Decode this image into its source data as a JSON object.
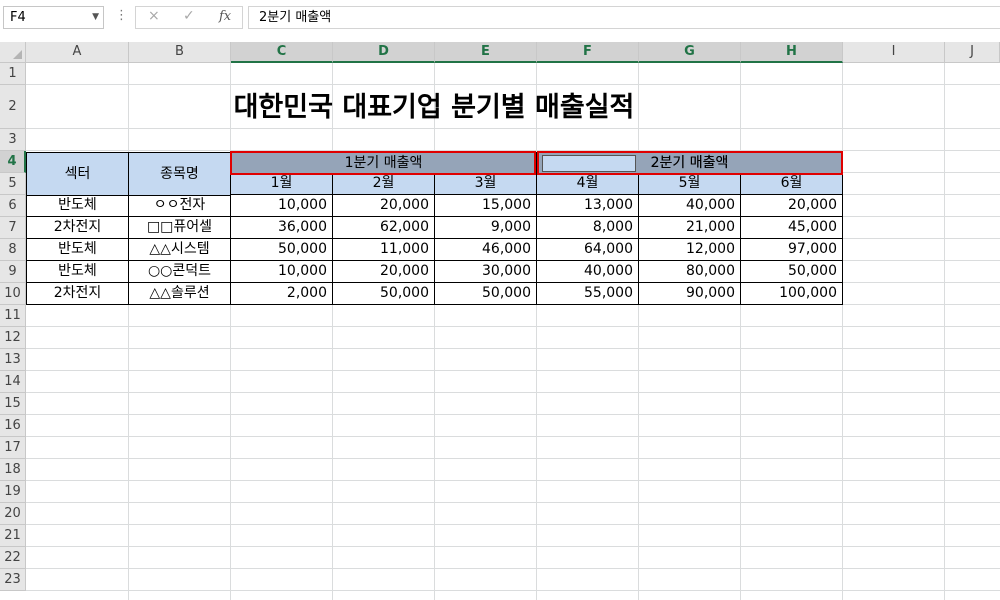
{
  "formula_bar": {
    "name_box": "F4",
    "cancel_icon": "×",
    "enter_icon": "✓",
    "fx_label": "fx",
    "formula": "2분기 매출액"
  },
  "columns": [
    "A",
    "B",
    "C",
    "D",
    "E",
    "F",
    "G",
    "H",
    "I",
    "J"
  ],
  "rows": [
    "1",
    "2",
    "3",
    "4",
    "5",
    "6",
    "7",
    "8",
    "9",
    "10",
    "11",
    "12",
    "13",
    "14",
    "15",
    "16",
    "17",
    "18",
    "19",
    "20",
    "21",
    "22",
    "23"
  ],
  "selected_column_range": [
    "C",
    "D",
    "E",
    "F",
    "G",
    "H"
  ],
  "selected_row": "4",
  "sheet": {
    "title": "대한민국 대표기업 분기별 매출실적",
    "headers": {
      "sector": "섹터",
      "stock": "종목명",
      "q1": "1분기 매출액",
      "q2": "2분기 매출액",
      "months": [
        "1월",
        "2월",
        "3월",
        "4월",
        "5월",
        "6월"
      ]
    },
    "data_rows": [
      {
        "sector": "반도체",
        "stock": "ㅇㅇ전자",
        "values": [
          "10,000",
          "20,000",
          "15,000",
          "13,000",
          "40,000",
          "20,000"
        ]
      },
      {
        "sector": "2차전지",
        "stock": "□□퓨어셀",
        "values": [
          "36,000",
          "62,000",
          "9,000",
          "8,000",
          "21,000",
          "45,000"
        ]
      },
      {
        "sector": "반도체",
        "stock": "△△시스템",
        "values": [
          "50,000",
          "11,000",
          "46,000",
          "64,000",
          "12,000",
          "97,000"
        ]
      },
      {
        "sector": "반도체",
        "stock": "○○콘덕트",
        "values": [
          "10,000",
          "20,000",
          "30,000",
          "40,000",
          "80,000",
          "50,000"
        ]
      },
      {
        "sector": "2차전지",
        "stock": "△△솔루션",
        "values": [
          "2,000",
          "50,000",
          "50,000",
          "55,000",
          "90,000",
          "100,000"
        ]
      }
    ]
  },
  "colors": {
    "header_blue": "#c5d9f1",
    "merged_gray": "#95a4b8",
    "highlight_red": "#e00000",
    "excel_green": "#217346"
  }
}
